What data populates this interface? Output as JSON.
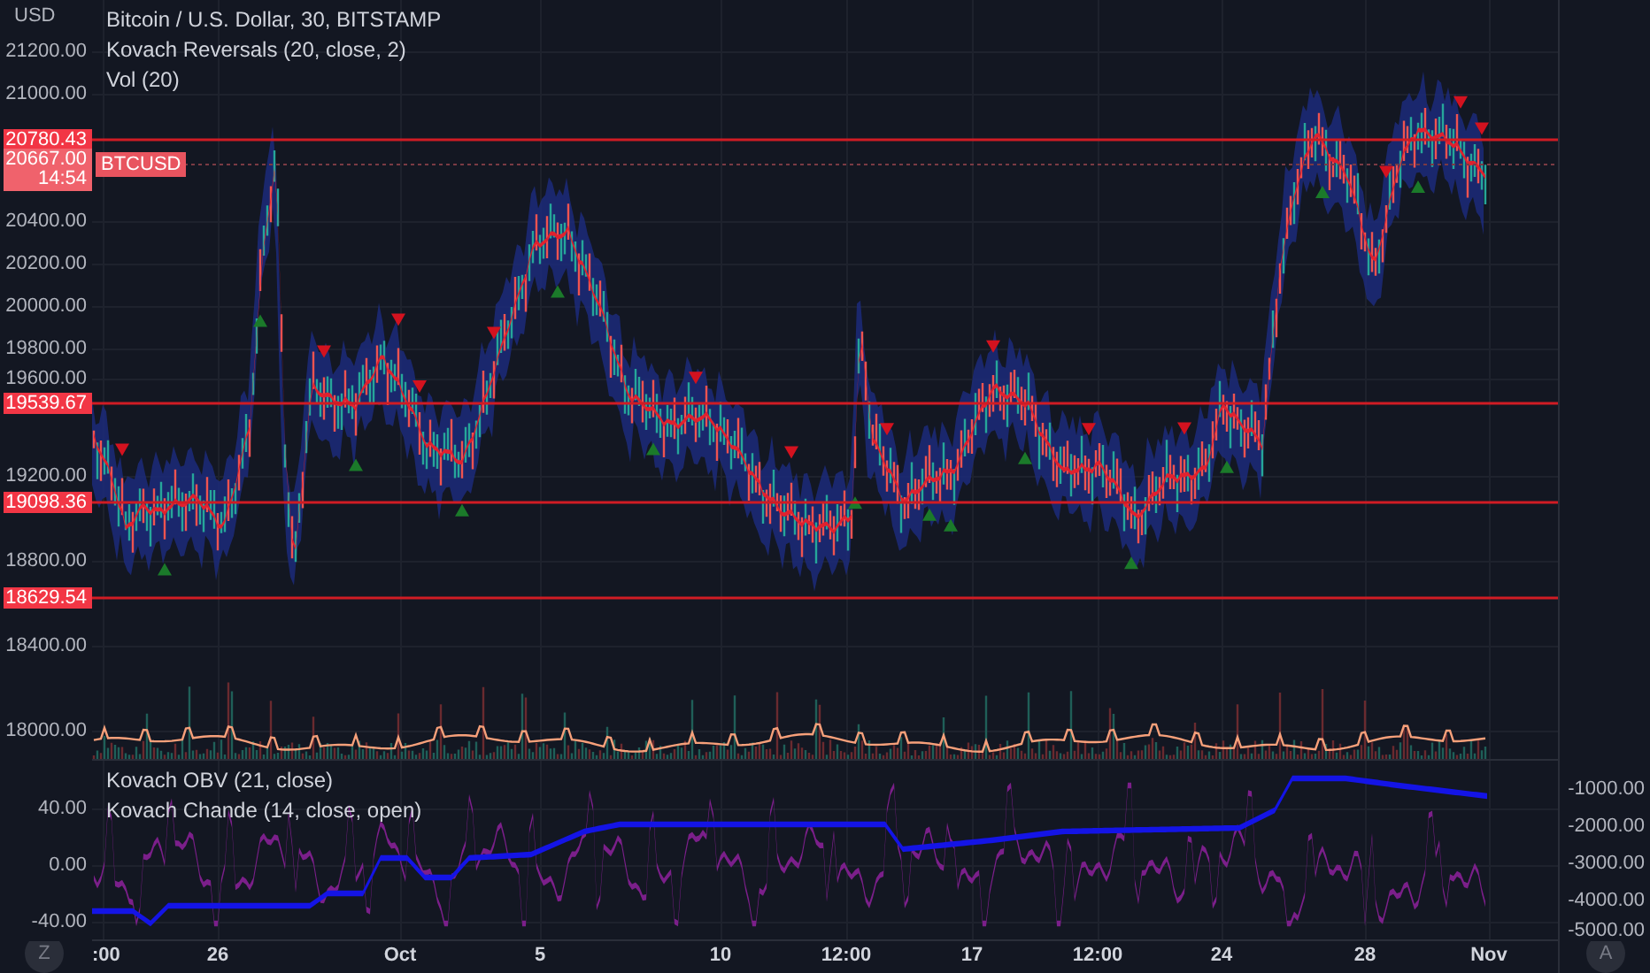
{
  "legend": {
    "title": "Bitcoin / U.S. Dollar, 30, BITSTAMP",
    "studies": [
      "Kovach Reversals (20, close, 2)",
      "Vol (20)"
    ]
  },
  "price_axis": {
    "unit": "USD",
    "ticks": [
      "21200.00",
      "21000.00",
      "20400.00",
      "20200.00",
      "20000.00",
      "19800.00",
      "19600.00",
      "19200.00",
      "18800.00",
      "18400.00",
      "18000.00"
    ]
  },
  "price_lines": [
    {
      "label": "20780.43"
    },
    {
      "label": "19539.67"
    },
    {
      "label": "19098.36"
    },
    {
      "label": "18629.54"
    }
  ],
  "last_price": {
    "value": "20667.00",
    "countdown": "14:54",
    "symbol": "BTCUSD"
  },
  "lower_pane": {
    "studies": [
      "Kovach OBV (21, close)",
      "Kovach Chande (14, close, open)"
    ],
    "left_ticks": [
      "40.00",
      "0.00",
      "-40.00"
    ],
    "right_ticks": [
      "-1000.00",
      "-2000.00",
      "-3000.00",
      "-4000.00",
      "-5000.00"
    ]
  },
  "time_axis": {
    "labels": [
      ":00",
      "26",
      "Oct",
      "5",
      "10",
      "12:00",
      "17",
      "12:00",
      "24",
      "28",
      "Nov"
    ]
  },
  "buttons": {
    "timezone": "Z",
    "auto_scale": "A"
  }
}
